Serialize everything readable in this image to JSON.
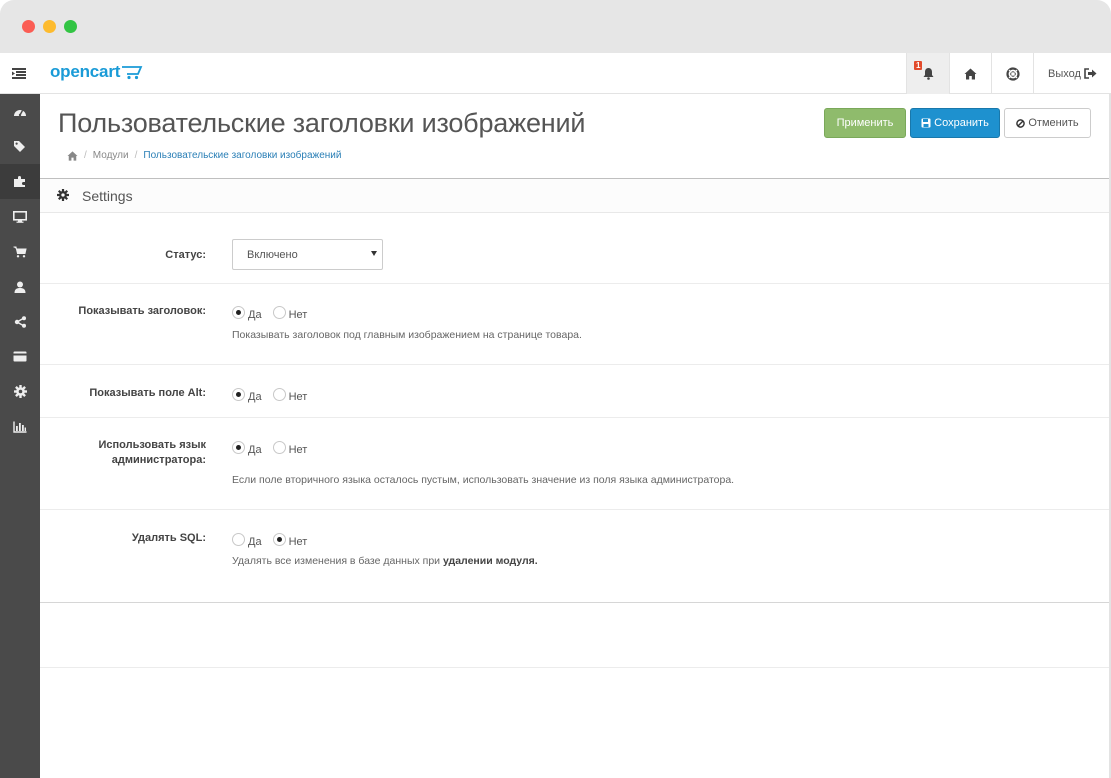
{
  "header": {
    "logo_text": "opencart",
    "notification_count": "1",
    "logout_label": "Выход"
  },
  "page": {
    "title": "Пользовательские заголовки изображений",
    "breadcrumb": {
      "modules": "Модули",
      "current": "Пользовательские заголовки изображений"
    }
  },
  "toolbar": {
    "apply_label": "Применить",
    "save_label": "Сохранить",
    "cancel_label": "Отменить"
  },
  "panel": {
    "title": "Settings"
  },
  "form": {
    "status": {
      "label": "Статус:",
      "value": "Включено"
    },
    "show_title": {
      "label": "Показывать заголовок:",
      "options": [
        "Да",
        "Нет"
      ],
      "selected": "Да",
      "help": "Показывать заголовок под главным изображением на странице товара."
    },
    "show_alt": {
      "label": "Показывать поле Alt:",
      "options": [
        "Да",
        "Нет"
      ],
      "selected": "Да"
    },
    "use_admin_lang": {
      "label_line1": "Использовать язык",
      "label_line2": "администратора:",
      "options": [
        "Да",
        "Нет"
      ],
      "selected": "Да",
      "help": "Если поле вторичного языка осталось пустым, использовать значение из поля языка администратора."
    },
    "delete_sql": {
      "label": "Удалять SQL:",
      "options": [
        "Да",
        "Нет"
      ],
      "selected": "Нет",
      "help_prefix": "Удалять все изменения в базе данных при ",
      "help_bold": "удалении модуля."
    }
  },
  "colors": {
    "brand": "#1a9bd7",
    "apply": "#8fbb6c",
    "save": "#1e91cf",
    "sidebar": "#4a4a4a",
    "badge": "#e24a2b"
  },
  "icons": {
    "sidebar": [
      "dashboard-icon",
      "tags-icon",
      "puzzle-icon",
      "desktop-icon",
      "cart-icon",
      "user-icon",
      "share-icon",
      "credit-card-icon",
      "cog-icon",
      "bar-chart-icon"
    ]
  }
}
